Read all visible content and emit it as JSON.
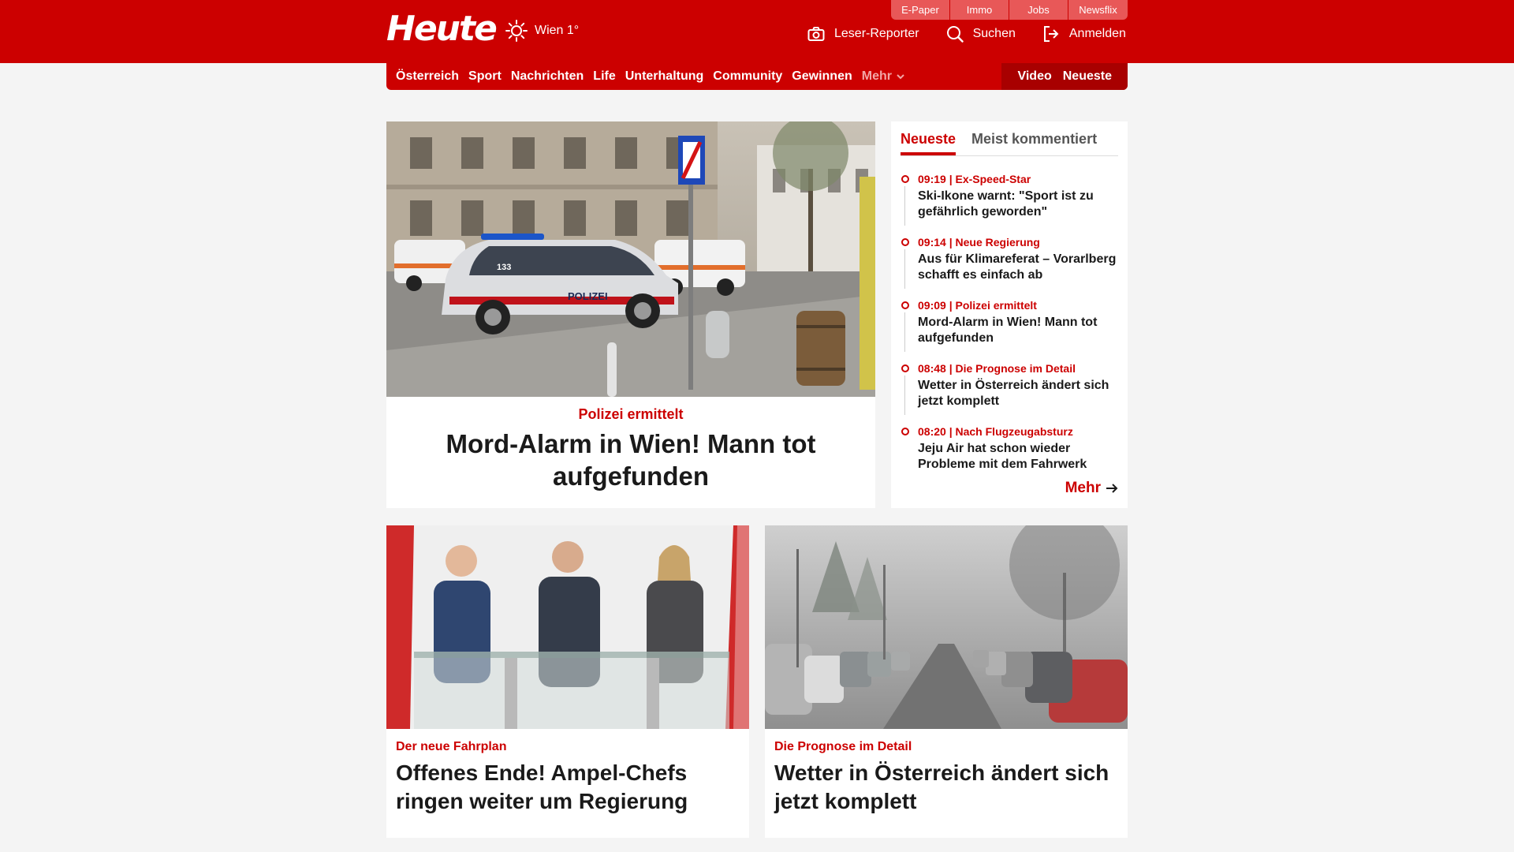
{
  "header": {
    "logo": "Heute",
    "weather": {
      "icon": "sun-icon",
      "text": "Wien 1°"
    },
    "service_tabs": [
      "E-Paper",
      "Immo",
      "Jobs",
      "Newsflix"
    ],
    "actions": {
      "reporter": "Leser-Reporter",
      "search": "Suchen",
      "login": "Anmelden"
    }
  },
  "nav": {
    "items": [
      "Österreich",
      "Sport",
      "Nachrichten",
      "Life",
      "Unterhaltung",
      "Community",
      "Gewinnen"
    ],
    "more": "Mehr",
    "right": [
      "Video",
      "Neueste"
    ]
  },
  "lead": {
    "kicker": "Polizei ermittelt",
    "headline": "Mord-Alarm in Wien! Mann tot aufgefunden",
    "image_label": "POLIZEI",
    "car_number": "133"
  },
  "sidebar": {
    "tabs": [
      "Neueste",
      "Meist kommentiert"
    ],
    "items": [
      {
        "meta": "09:19 | Ex-Speed-Star",
        "title": "Ski-Ikone warnt: \"Sport ist zu gefährlich geworden\""
      },
      {
        "meta": "09:14 | Neue Regierung",
        "title": "Aus für Klimareferat – Vorarlberg schafft es einfach ab"
      },
      {
        "meta": "09:09 | Polizei ermittelt",
        "title": "Mord-Alarm in Wien! Mann tot aufgefunden"
      },
      {
        "meta": "08:48 | Die Prognose im Detail",
        "title": "Wetter in Österreich ändert sich jetzt komplett"
      },
      {
        "meta": "08:20 | Nach Flugzeugabsturz",
        "title": "Jeju Air hat schon wieder Probleme mit dem Fahrwerk"
      }
    ],
    "more": "Mehr"
  },
  "cards": [
    {
      "kicker": "Der neue Fahrplan",
      "headline": "Offenes Ende! Ampel-Chefs ringen weiter um Regierung"
    },
    {
      "kicker": "Die Prognose im Detail",
      "headline": "Wetter in Österreich ändert sich jetzt komplett"
    }
  ],
  "colors": {
    "brand": "#cc0000",
    "brand_dark": "#a80000",
    "tab_bg": "#e85858",
    "background": "#f4f4f4"
  }
}
